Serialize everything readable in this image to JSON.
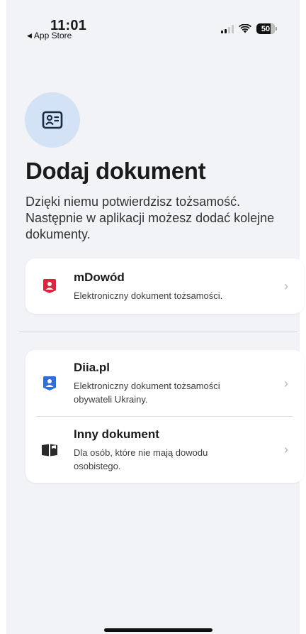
{
  "status_bar": {
    "time": "11:01",
    "back_label": "App Store",
    "battery_level": "50"
  },
  "header": {
    "icon": "id-card-icon",
    "title": "Dodaj dokument",
    "subtitle": "Dzięki niemu potwierdzisz tożsamość. Następnie w aplikacji możesz dodać kolejne dokumenty."
  },
  "documents_primary": [
    {
      "icon": "mdowod-icon",
      "name": "mDowód",
      "description": "Elektroniczny dokument tożsamości."
    }
  ],
  "documents_other": [
    {
      "icon": "diia-icon",
      "name": "Diia.pl",
      "description": "Elektroniczny dokument tożsamości obywateli Ukrainy."
    },
    {
      "icon": "open-book-icon",
      "name": "Inny dokument",
      "description": "Dla osób, które nie mają dowodu osobistego."
    }
  ],
  "colors": {
    "background": "#f2f3f6",
    "mdowod_red": "#d7263d",
    "diia_blue": "#2f6fd6",
    "icon_circle": "#d4e2f5"
  }
}
